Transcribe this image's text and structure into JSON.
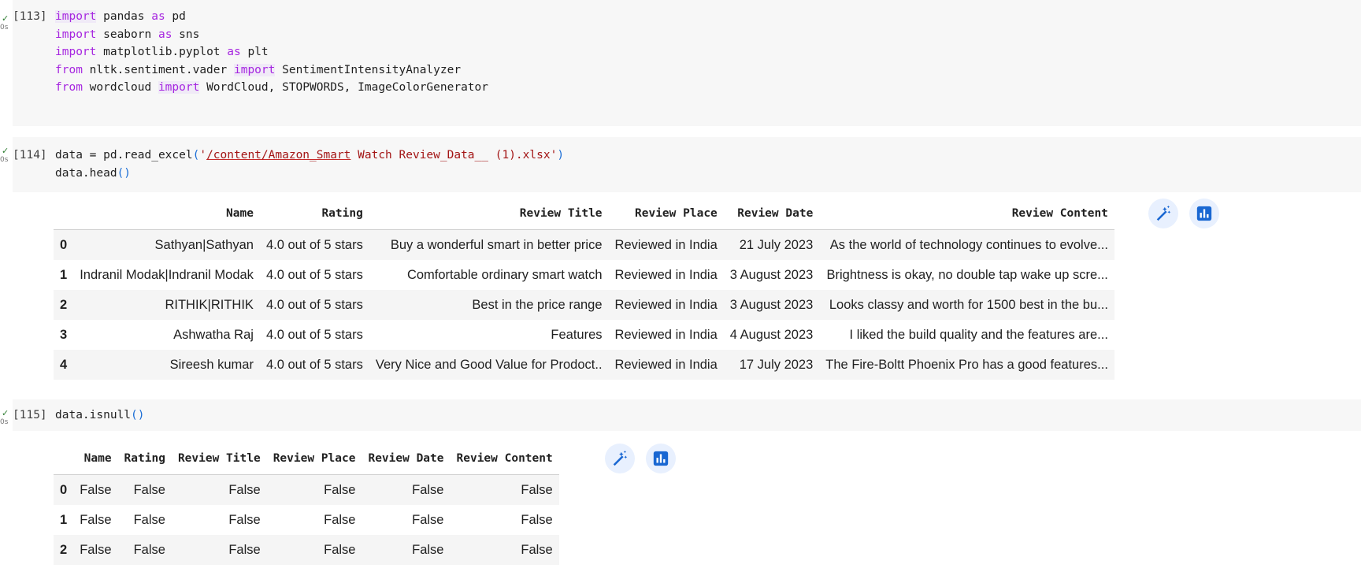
{
  "cells": [
    {
      "exec_count": "[113]",
      "run_time": "0s",
      "code_lines": [
        [
          {
            "t": "import",
            "c": "kw hl"
          },
          {
            "t": " pandas "
          },
          {
            "t": "as",
            "c": "kw"
          },
          {
            "t": " pd"
          }
        ],
        [
          {
            "t": "import",
            "c": "kw"
          },
          {
            "t": " seaborn "
          },
          {
            "t": "as",
            "c": "kw"
          },
          {
            "t": " sns"
          }
        ],
        [
          {
            "t": "import",
            "c": "kw"
          },
          {
            "t": " matplotlib.pyplot "
          },
          {
            "t": "as",
            "c": "kw"
          },
          {
            "t": " plt"
          }
        ],
        [
          {
            "t": "from",
            "c": "kw"
          },
          {
            "t": " nltk.sentiment.vader "
          },
          {
            "t": "import",
            "c": "kw hl"
          },
          {
            "t": " SentimentIntensityAnalyzer"
          }
        ],
        [
          {
            "t": "from",
            "c": "kw"
          },
          {
            "t": " wordcloud "
          },
          {
            "t": "import",
            "c": "kw hl"
          },
          {
            "t": " WordCloud, STOPWORDS, ImageColorGenerator"
          }
        ]
      ]
    },
    {
      "exec_count": "[114]",
      "run_time": "0s",
      "code_lines": [
        [
          {
            "t": "data = pd.read_excel"
          },
          {
            "t": "(",
            "c": "par"
          },
          {
            "t": "'",
            "c": "str"
          },
          {
            "t": "/content/Amazon_Smart",
            "c": "str ul"
          },
          {
            "t": " Watch Review_Data__ (1).xlsx'",
            "c": "str"
          },
          {
            "t": ")",
            "c": "par"
          }
        ],
        [
          {
            "t": "data.head"
          },
          {
            "t": "()",
            "c": "par"
          }
        ]
      ]
    },
    {
      "exec_count": "[115]",
      "run_time": "0s",
      "code_lines": [
        [
          {
            "t": "data.isnull"
          },
          {
            "t": "()",
            "c": "par"
          }
        ]
      ]
    }
  ],
  "head_table": {
    "columns": [
      "",
      "Name",
      "Rating",
      "Review Title",
      "Review Place",
      "Review Date",
      "Review Content"
    ],
    "rows": [
      [
        "0",
        "Sathyan|Sathyan",
        "4.0 out of 5 stars",
        "Buy a wonderful smart in better price",
        "Reviewed in India",
        "21 July 2023",
        "As the world of technology continues to evolve..."
      ],
      [
        "1",
        "Indranil Modak|Indranil Modak",
        "4.0 out of 5 stars",
        "Comfortable ordinary smart watch",
        "Reviewed in India",
        "3 August 2023",
        "Brightness is okay, no double tap wake up scre..."
      ],
      [
        "2",
        "RITHIK|RITHIK",
        "4.0 out of 5 stars",
        "Best in the price range",
        "Reviewed in India",
        "3 August 2023",
        "Looks classy and worth for 1500 best in the bu..."
      ],
      [
        "3",
        "Ashwatha Raj",
        "4.0 out of 5 stars",
        "Features",
        "Reviewed in India",
        "4 August 2023",
        "I liked the build quality and the features are..."
      ],
      [
        "4",
        "Sireesh kumar",
        "4.0 out of 5 stars",
        "Very Nice and Good Value for Prodoct..",
        "Reviewed in India",
        "17 July 2023",
        "The Fire-Boltt Phoenix Pro has a good features..."
      ]
    ]
  },
  "null_table": {
    "columns": [
      "",
      "Name",
      "Rating",
      "Review Title",
      "Review Place",
      "Review Date",
      "Review Content"
    ],
    "rows": [
      [
        "0",
        "False",
        "False",
        "False",
        "False",
        "False",
        "False"
      ],
      [
        "1",
        "False",
        "False",
        "False",
        "False",
        "False",
        "False"
      ],
      [
        "2",
        "False",
        "False",
        "False",
        "False",
        "False",
        "False"
      ]
    ]
  },
  "icons": {
    "magic": "magic-wand-icon",
    "chart": "bar-chart-icon",
    "check": "✓"
  },
  "colors": {
    "accent": "#1967d2",
    "keyword": "#a626e0",
    "string": "#a31515"
  }
}
